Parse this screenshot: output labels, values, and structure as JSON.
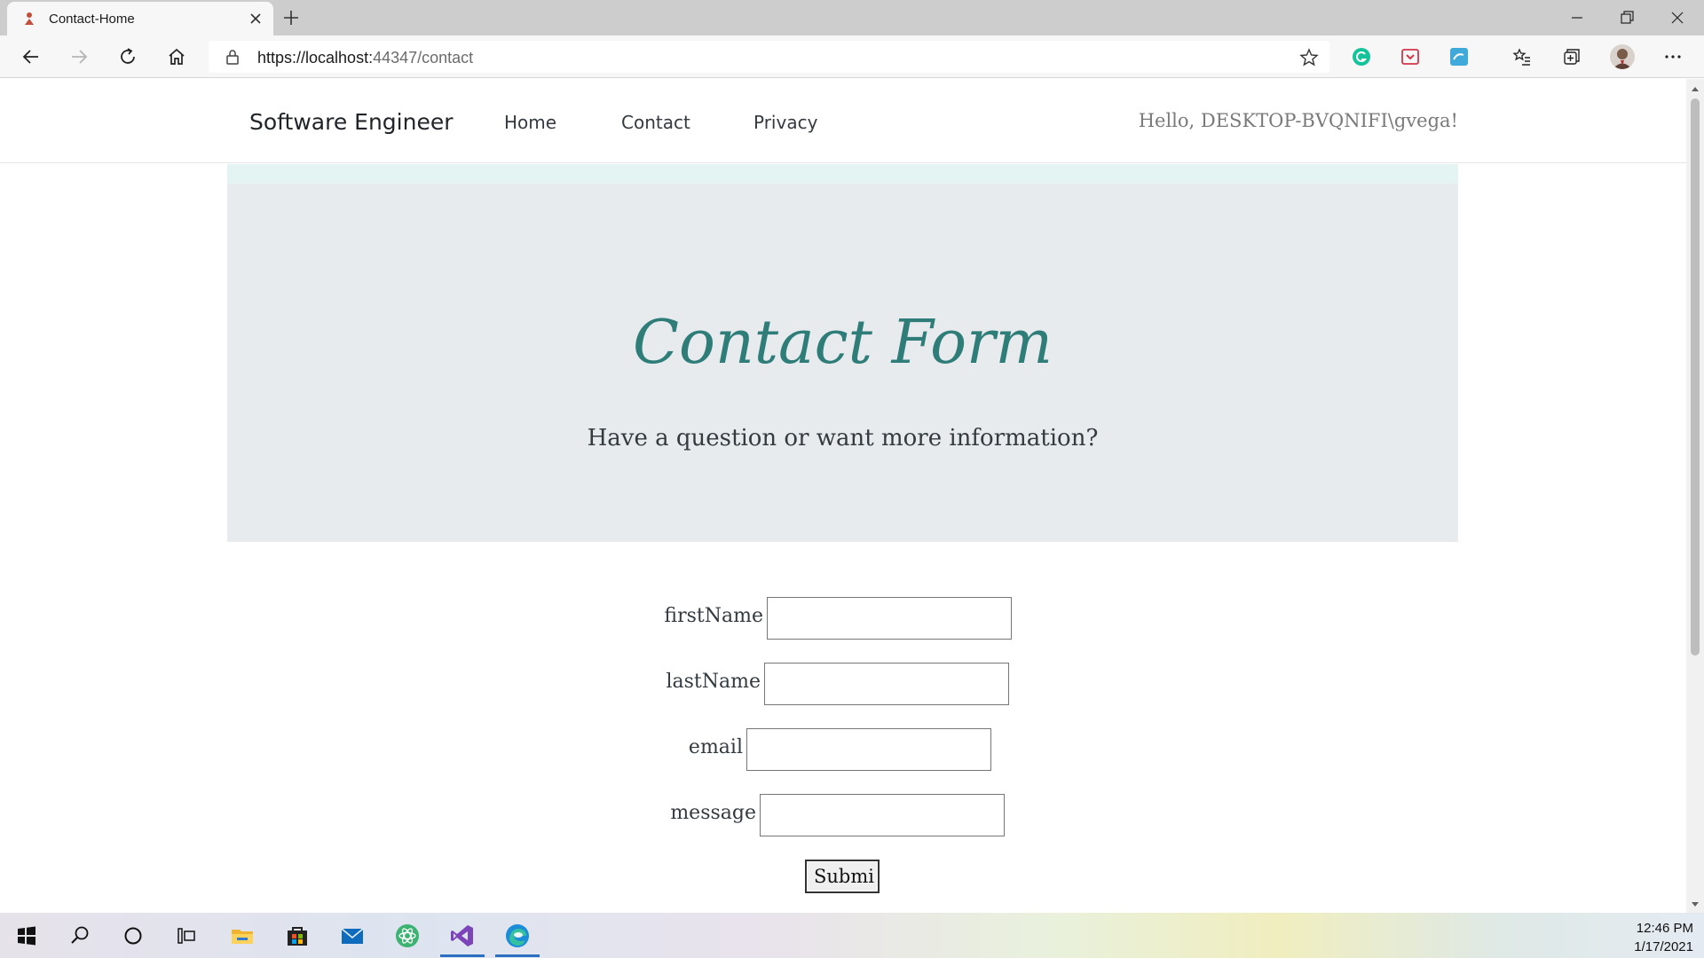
{
  "browser": {
    "tab_title": "Contact-Home",
    "url_base": "https://localhost:",
    "url_rest": "44347/contact"
  },
  "site": {
    "brand": "Software Engineer",
    "nav": [
      "Home",
      "Contact",
      "Privacy"
    ],
    "greeting": "Hello, DESKTOP-BVQNIFI\\gvega!"
  },
  "hero": {
    "title": "Contact Form",
    "subtitle": "Have a question or want more information?"
  },
  "form": {
    "fields": [
      {
        "label": "firstName",
        "value": ""
      },
      {
        "label": "lastName",
        "value": ""
      },
      {
        "label": "email",
        "value": ""
      },
      {
        "label": "message",
        "value": ""
      }
    ],
    "submit_label": "Submi"
  },
  "taskbar": {
    "time": "12:46 PM",
    "date": "1/17/2021"
  },
  "colors": {
    "accent_teal": "#2f7d79",
    "hero_bg": "#e8ebee",
    "mint_strip": "#e3f4f2"
  }
}
